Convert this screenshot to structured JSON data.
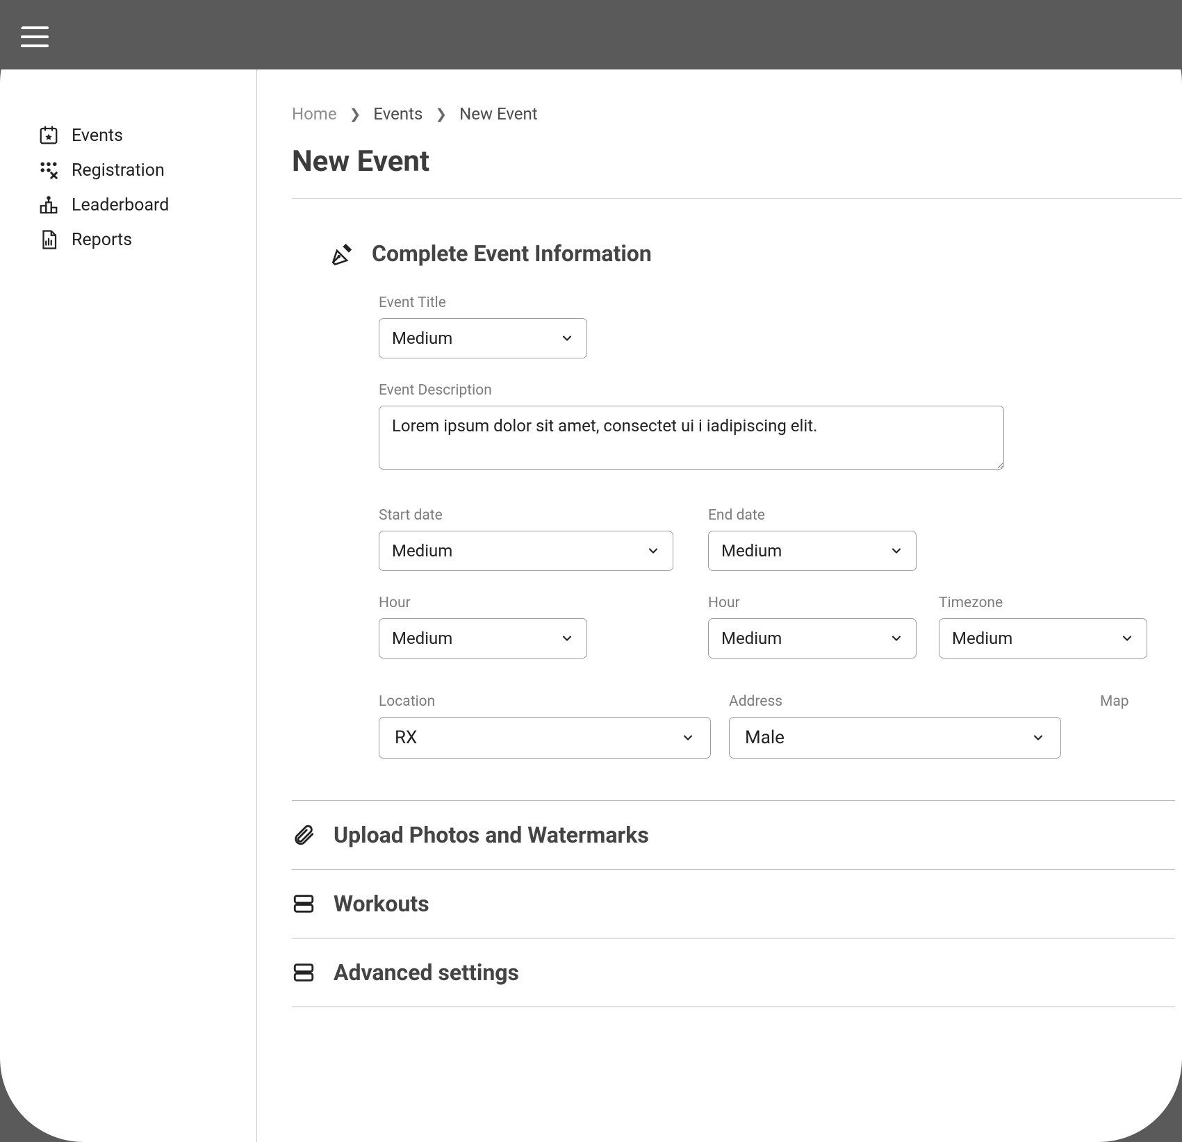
{
  "sidebar": {
    "items": [
      {
        "label": "Events"
      },
      {
        "label": "Registration"
      },
      {
        "label": "Leaderboard"
      },
      {
        "label": "Reports"
      }
    ]
  },
  "breadcrumb": {
    "home": "Home",
    "events": "Events",
    "current": "New Event"
  },
  "page_title": "New Event",
  "section_info": {
    "title": "Complete Event Information",
    "event_title_label": "Event Title",
    "event_title_value": "Medium",
    "event_desc_label": "Event Description",
    "event_desc_value": "Lorem ipsum dolor sit amet, consectet ui i iadipiscing elit.",
    "start_date_label": "Start date",
    "start_date_value": "Medium",
    "end_date_label": "End date",
    "end_date_value": "Medium",
    "hour1_label": "Hour",
    "hour1_value": "Medium",
    "hour2_label": "Hour",
    "hour2_value": "Medium",
    "timezone_label": "Timezone",
    "timezone_value": "Medium",
    "location_label": "Location",
    "location_value": "RX",
    "address_label": "Address",
    "address_value": "Male",
    "map_label": "Map"
  },
  "section_upload": {
    "title": "Upload Photos and Watermarks"
  },
  "section_workouts": {
    "title": "Workouts"
  },
  "section_advanced": {
    "title": "Advanced settings"
  }
}
